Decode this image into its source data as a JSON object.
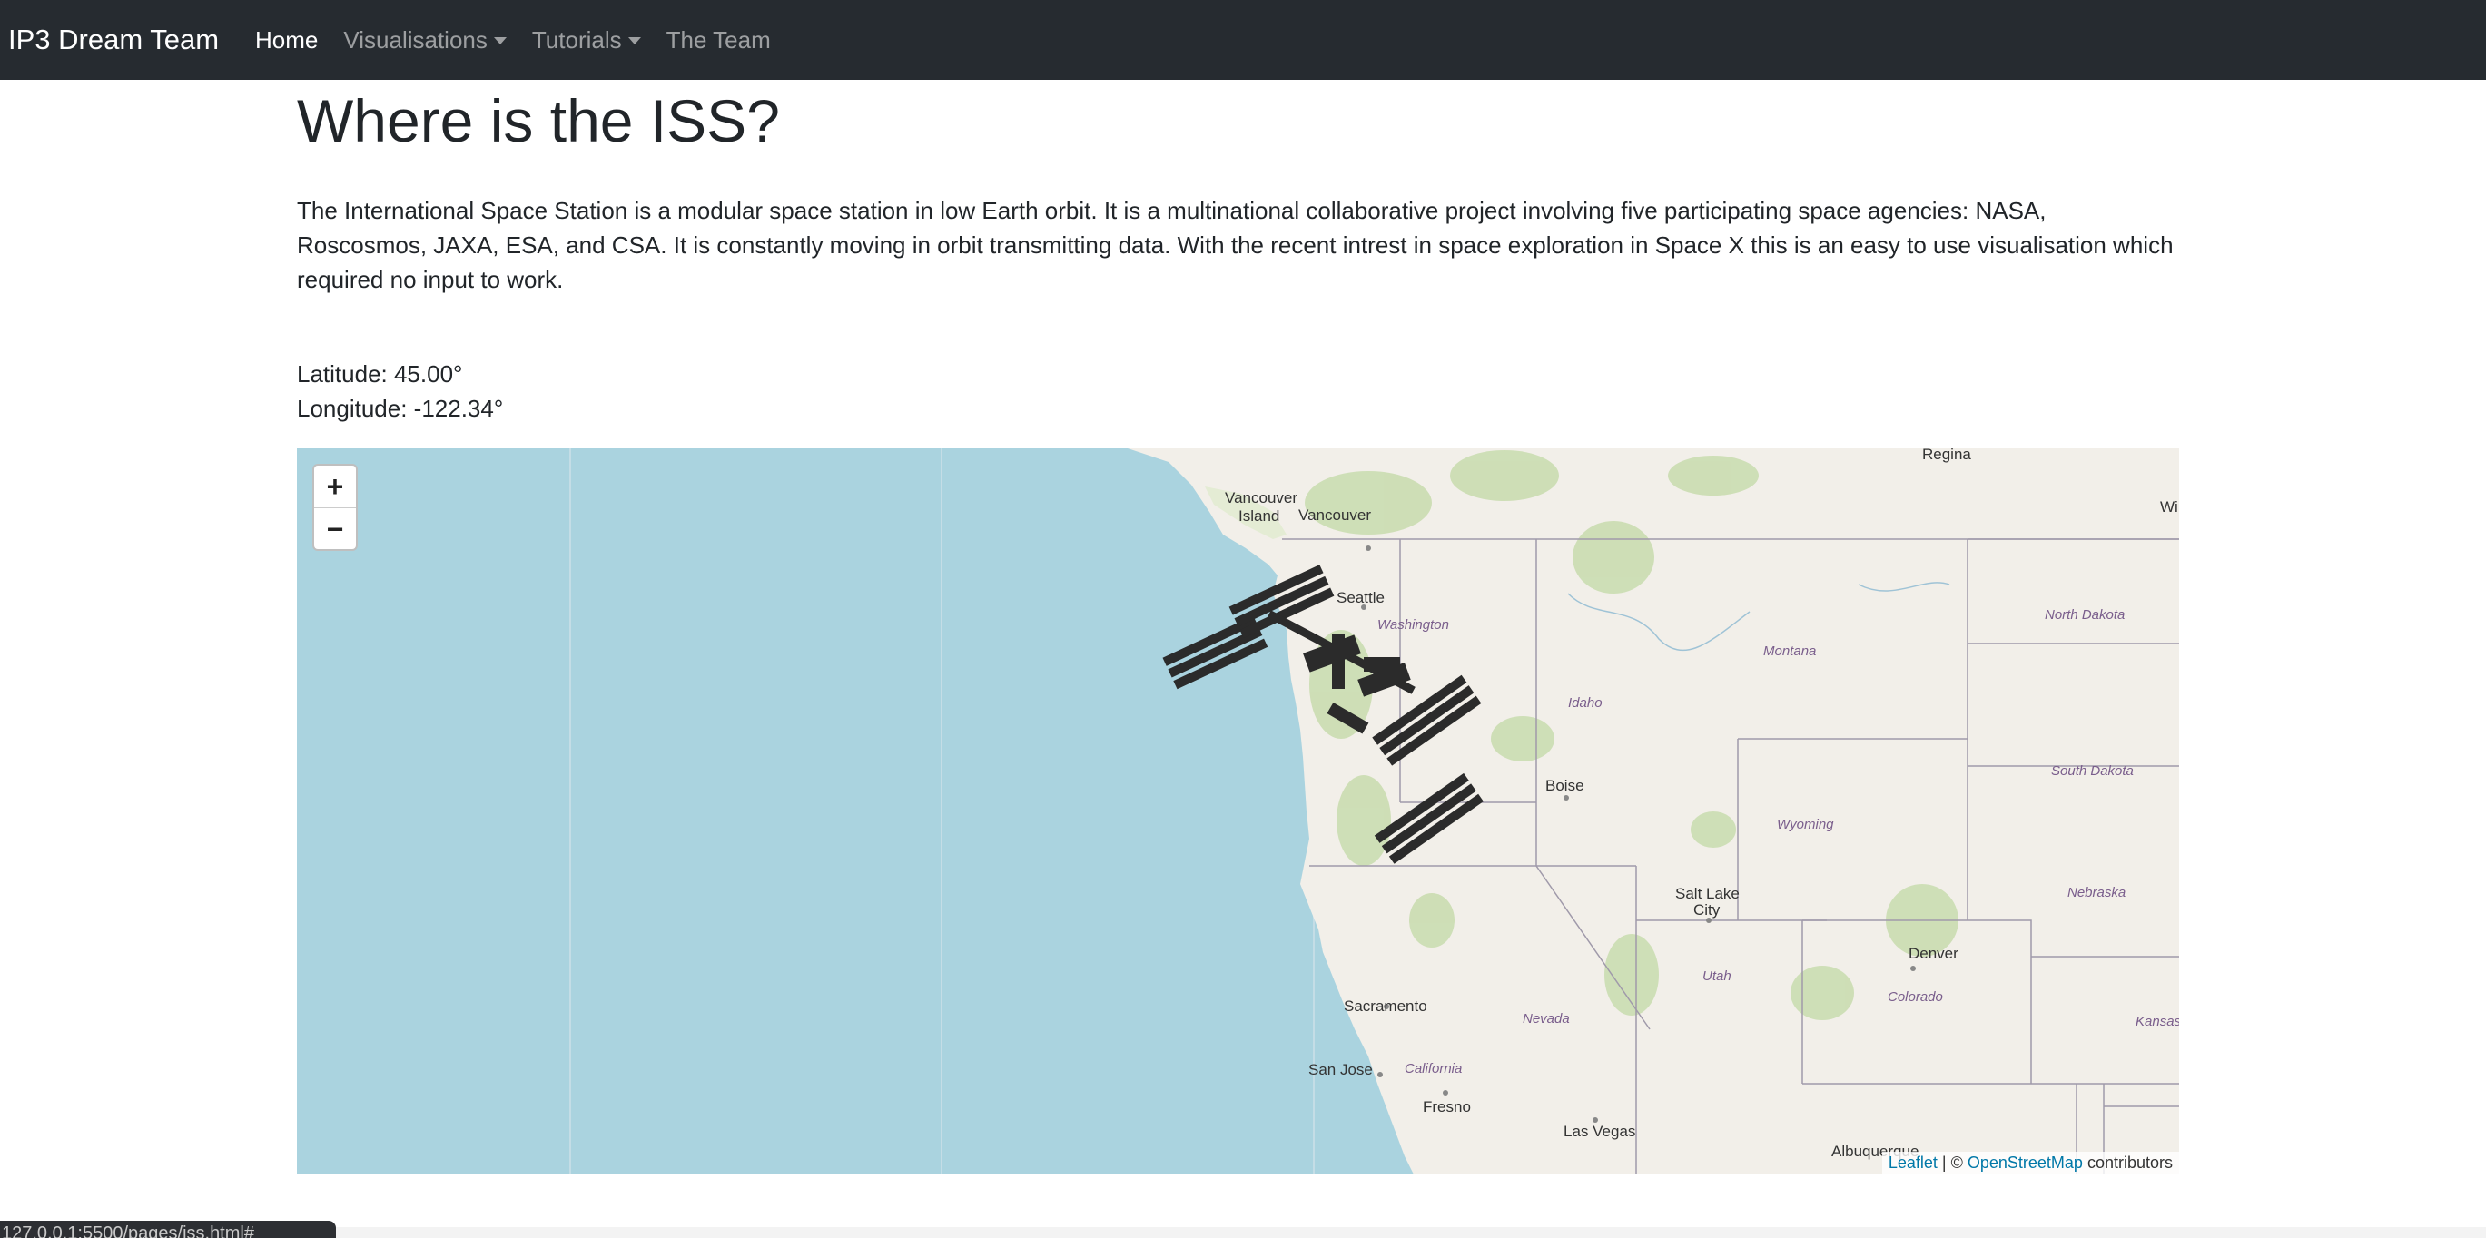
{
  "navbar": {
    "brand": "IP3 Dream Team",
    "items": [
      {
        "label": "Home",
        "active": true,
        "dropdown": false
      },
      {
        "label": "Visualisations",
        "active": false,
        "dropdown": true
      },
      {
        "label": "Tutorials",
        "active": false,
        "dropdown": true
      },
      {
        "label": "The Team",
        "active": false,
        "dropdown": false
      }
    ]
  },
  "page": {
    "title": "Where is the ISS?",
    "intro": "The International Space Station is a modular space station in low Earth orbit. It is a multinational collaborative project involving five participating space agencies: NASA, Roscosmos, JAXA, ESA, and CSA. It is constantly moving in orbit transmitting data. With the recent intrest in space exploration in Space X this is an easy to use visualisation which required no input to work.",
    "latitude": "Latitude: 45.00°",
    "longitude": "Longitude: -122.34°"
  },
  "map": {
    "zoom_in": "+",
    "zoom_out": "−",
    "attribution": {
      "leaflet": "Leaflet",
      "separator": " | © ",
      "osm": "OpenStreetMap",
      "suffix": " contributors"
    },
    "labels": {
      "vancouver_island_1": "Vancouver",
      "vancouver_island_2": "Island",
      "vancouver": "Vancouver",
      "regina": "Regina",
      "wi": "Wi",
      "seattle": "Seattle",
      "washington": "Washington",
      "idaho": "Idaho",
      "montana": "Montana",
      "north_dakota": "North Dakota",
      "south_dakota": "South Dakota",
      "boise": "Boise",
      "wyoming": "Wyoming",
      "nebraska": "Nebraska",
      "salt_lake_1": "Salt Lake",
      "salt_lake_2": "City",
      "denver": "Denver",
      "utah": "Utah",
      "colorado": "Colorado",
      "kansas": "Kansas",
      "nevada": "Nevada",
      "sacramento": "Sacramento",
      "california": "California",
      "san_jose": "San Jose",
      "fresno": "Fresno",
      "las_vegas": "Las Vegas",
      "albuquerque": "Albuquerque"
    },
    "colors": {
      "water": "#aad3df",
      "land": "#f2efe9",
      "forest": "#c8dcae",
      "border": "#a09aaa"
    }
  },
  "status_bar": {
    "url": "127.0.0.1:5500/pages/iss.html#"
  }
}
